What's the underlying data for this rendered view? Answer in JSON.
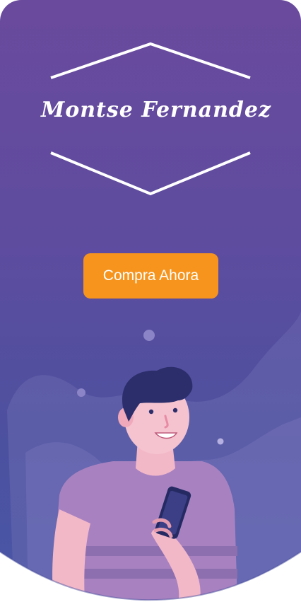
{
  "brand": {
    "logo_text": "Montse Fernandez"
  },
  "cta": {
    "label": "Compra Ahora"
  },
  "colors": {
    "background_top": "#6a4a9d",
    "background_bottom": "#4a57a8",
    "button": "#f7941d",
    "button_text": "#ffffff"
  },
  "icons": {
    "illustration": "man-with-phone-illustration",
    "logo": "hexagon-signature-logo"
  }
}
